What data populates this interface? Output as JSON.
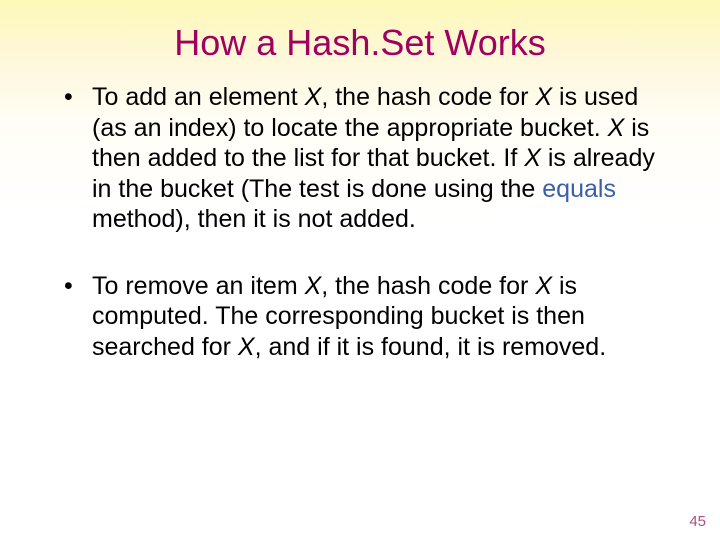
{
  "title": "How a Hash.Set Works",
  "bullets": [
    {
      "t0": "To add an element ",
      "x0": "X",
      "t1": ", the hash code for ",
      "x1": "X",
      "t2": " is used (as an index) to locate the appropriate bucket. ",
      "x2": "X",
      "t3": " is then added to the list for that bucket. If ",
      "x3": "X",
      "t4": " is already in the bucket (The test is done using the ",
      "kw": "equals",
      "t5": " method), then it is not added."
    },
    {
      "t0": "To remove an item ",
      "x0": "X",
      "t1": ", the hash code for ",
      "x1": "X",
      "t2": " is computed. The corresponding bucket is then searched for ",
      "x2": "X",
      "t3": ", and if it is found, it is removed."
    }
  ],
  "page_number": "45"
}
